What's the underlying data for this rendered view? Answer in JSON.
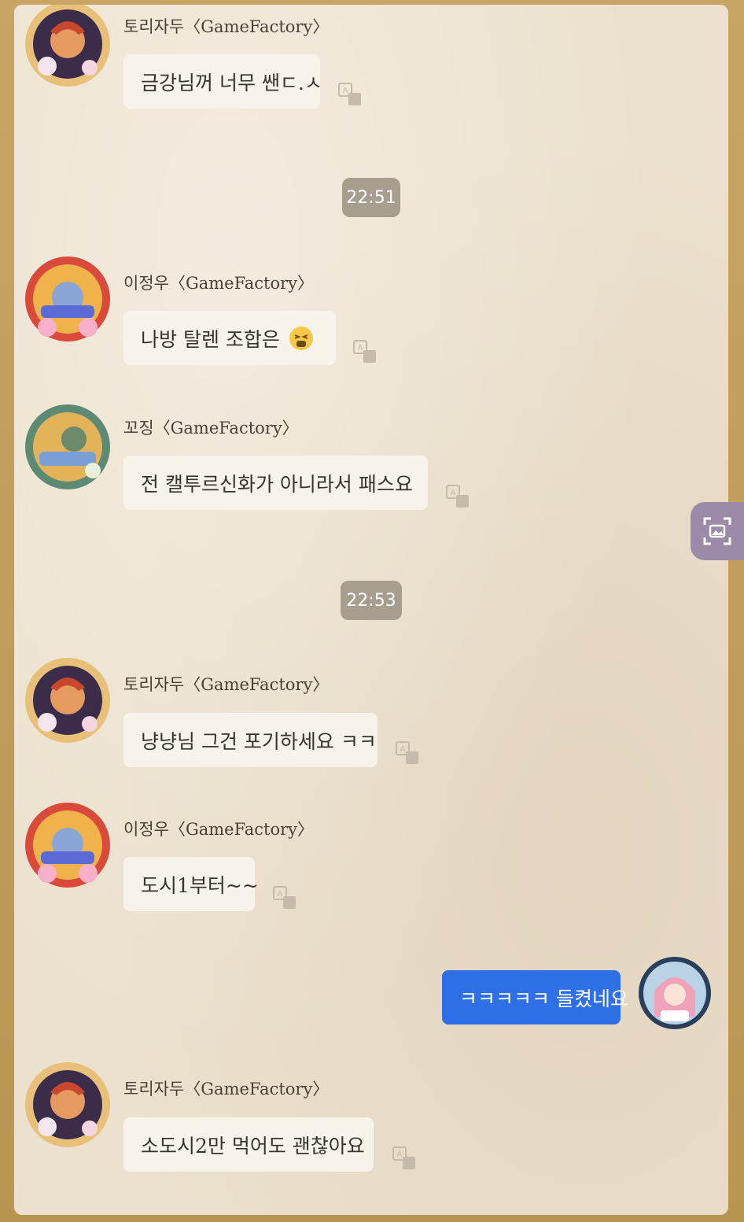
{
  "chat": {
    "messages": [
      {
        "sender": "토리자두〈GameFactory〉",
        "text": "금강님꺼 너무 쌘ㄷ.ㅅ",
        "avatar": "torijadu-avatar"
      },
      {
        "time": "22:51"
      },
      {
        "sender": "이정우〈GameFactory〉",
        "text": "나방 탈렌 조합은",
        "emoji": "tired-face-emoji",
        "avatar": "leejungwoo-avatar"
      },
      {
        "sender": "꼬징〈GameFactory〉",
        "text": "전 캘투르신화가 아니라서 패스요",
        "avatar": "kkojing-avatar"
      },
      {
        "time": "22:53"
      },
      {
        "sender": "토리자두〈GameFactory〉",
        "text": "냥냥님 그건 포기하세요 ㅋㅋ",
        "avatar": "torijadu-avatar"
      },
      {
        "sender": "이정우〈GameFactory〉",
        "text": "도시1부터~~",
        "avatar": "leejungwoo-avatar"
      },
      {
        "own": true,
        "text": "ㅋㅋㅋㅋㅋ 들켰네요",
        "avatar": "my-avatar"
      },
      {
        "sender": "토리자두〈GameFactory〉",
        "text": "소도시2만 먹어도 괜찮아요",
        "avatar": "torijadu-avatar"
      }
    ]
  },
  "icons": {
    "translate": "translate-icon",
    "capture": "screen-capture-icon"
  },
  "colors": {
    "frame": "#c8a565",
    "panel": "#ece1ce",
    "bubble": "#f8f3ea",
    "own_bubble": "#2f6fe6",
    "time_pill": "#a89e8f",
    "capture_button": "#9b8aa8"
  }
}
